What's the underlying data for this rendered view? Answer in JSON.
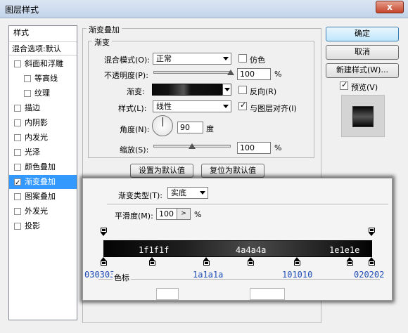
{
  "window": {
    "title": "图层样式",
    "close_label": "x"
  },
  "styles_panel": {
    "items": [
      {
        "label": "样式",
        "type": "header"
      },
      {
        "label": "混合选项:默认",
        "type": "header"
      },
      {
        "label": "斜面和浮雕",
        "checked": false
      },
      {
        "label": "等高线",
        "checked": false,
        "indent": true
      },
      {
        "label": "纹理",
        "checked": false,
        "indent": true
      },
      {
        "label": "描边",
        "checked": false
      },
      {
        "label": "内阴影",
        "checked": false
      },
      {
        "label": "内发光",
        "checked": false
      },
      {
        "label": "光泽",
        "checked": false
      },
      {
        "label": "颜色叠加",
        "checked": false
      },
      {
        "label": "渐变叠加",
        "checked": true,
        "selected": true
      },
      {
        "label": "图案叠加",
        "checked": false
      },
      {
        "label": "外发光",
        "checked": false
      },
      {
        "label": "投影",
        "checked": false
      }
    ]
  },
  "gradient_overlay": {
    "group_title": "渐变叠加",
    "sub_title": "渐变",
    "blend_mode_label": "混合模式(O):",
    "blend_mode_value": "正常",
    "dither_label": "仿色",
    "opacity_label": "不透明度(P):",
    "opacity_value": "100",
    "percent": "%",
    "gradient_label": "渐变:",
    "reverse_label": "反向(R)",
    "style_label": "样式(L):",
    "style_value": "线性",
    "align_label": "与图层对齐(I)",
    "align_checked": true,
    "angle_label": "角度(N):",
    "angle_value": "90",
    "degree_unit": "度",
    "scale_label": "缩放(S):",
    "scale_value": "100",
    "set_default": "设置为默认值",
    "reset_default": "复位为默认值",
    "opacity_level": 1.0,
    "scale_level": 0.5
  },
  "buttons": {
    "ok": "确定",
    "cancel": "取消",
    "new_style": "新建样式(W)...",
    "preview": "预览(V)",
    "preview_checked": true
  },
  "gradient_editor": {
    "type_label": "渐变类型(T):",
    "type_value": "实底",
    "smooth_label": "平滑度(M):",
    "smooth_value": "100",
    "smooth_step": ">",
    "percent": "%",
    "color_stop_label": "色标",
    "bar_labels": [
      "1f1f1f",
      "4a4a4a",
      "1e1e1e"
    ],
    "stop_labels": [
      "030303",
      "1a1a1a",
      "101010",
      "020202"
    ],
    "colors": [
      "#030303",
      "#1f1f1f",
      "#4a4a4a",
      "#1e1e1e",
      "#020202"
    ]
  }
}
